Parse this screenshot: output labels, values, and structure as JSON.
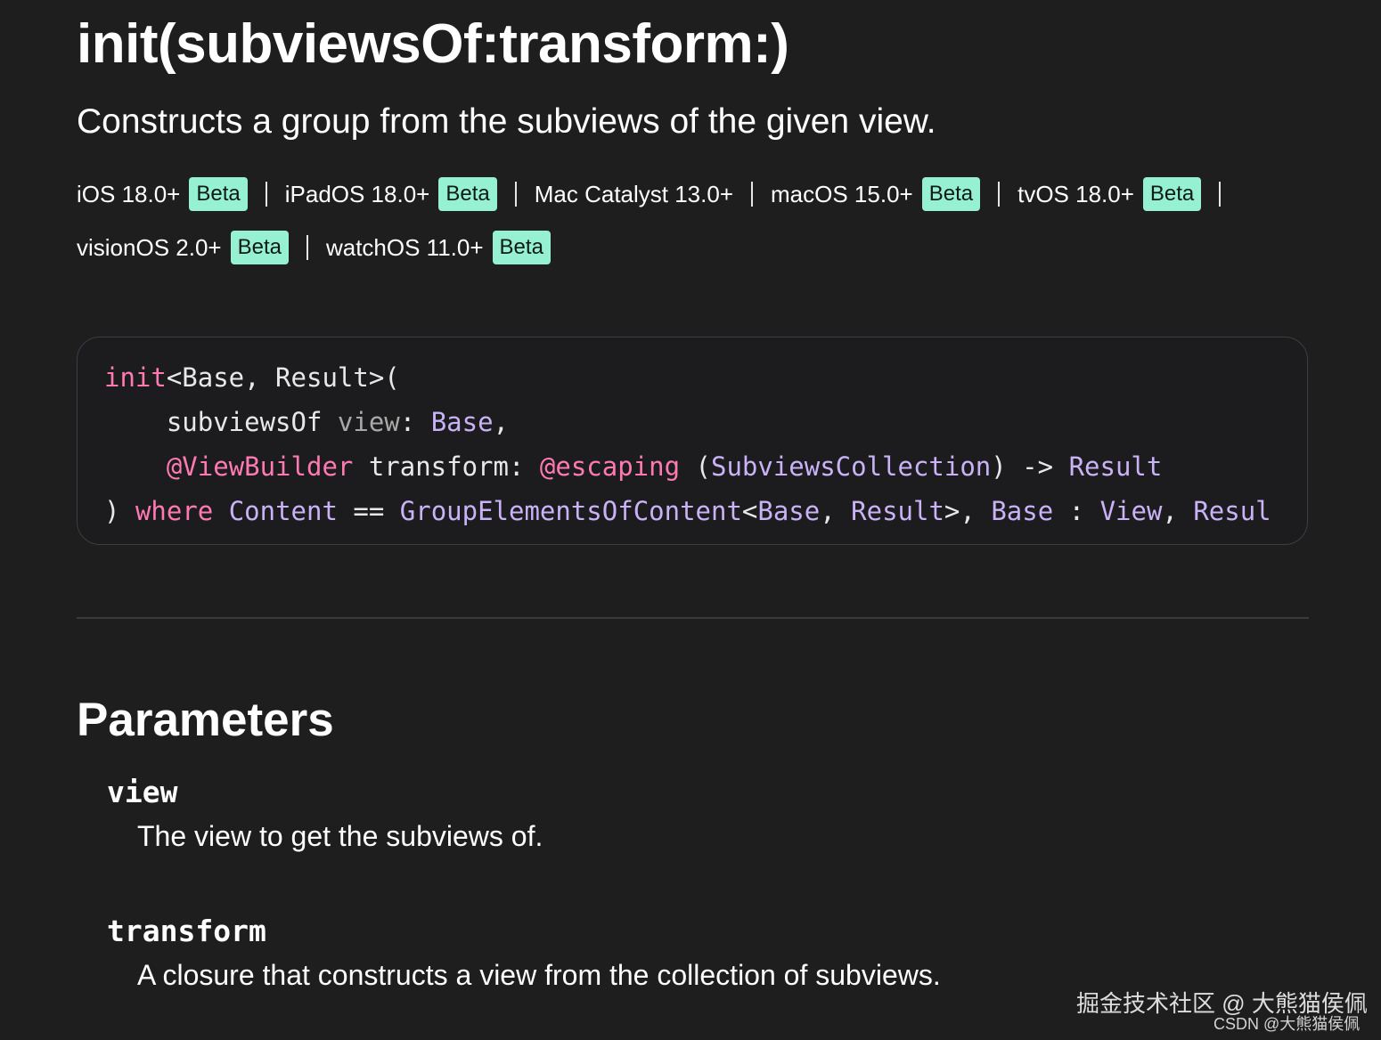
{
  "title": "init(subviewsOf:transform:)",
  "abstract": "Constructs a group from the subviews of the given view.",
  "availability": {
    "row1": [
      {
        "platform": "iOS 18.0+",
        "badge": "Beta"
      },
      {
        "platform": "iPadOS 18.0+",
        "badge": "Beta"
      },
      {
        "platform": "Mac Catalyst 13.0+"
      },
      {
        "platform": "macOS 15.0+",
        "badge": "Beta"
      },
      {
        "platform": "tvOS 18.0+",
        "badge": "Beta"
      }
    ],
    "row2": [
      {
        "platform": "visionOS 2.0+",
        "badge": "Beta"
      },
      {
        "platform": "watchOS 11.0+",
        "badge": "Beta"
      }
    ],
    "badge_color": "#96f0d2"
  },
  "declaration": {
    "line1": {
      "kw": "init",
      "rest": "<Base, Result>("
    },
    "line2": {
      "label": "subviewsOf",
      "param": "view",
      "colon": ":",
      "type": "Base",
      "comma": ","
    },
    "line3": {
      "attr": "@ViewBuilder",
      "label": "transform",
      "colon": ":",
      "escaping": "@escaping",
      "open": "(",
      "type1": "SubviewsCollection",
      "arrow": ") ->",
      "type2": "Result"
    },
    "line4": {
      "close": ")",
      "where": "where",
      "content": "Content",
      "eq": "==",
      "type": "GroupElementsOfContent",
      "lt": "<",
      "base": "Base",
      "comma1": ",",
      "result": "Result",
      "gt": ">,",
      "base2": "Base",
      "colon": ":",
      "view": "View",
      "comma2": ",",
      "resul": "Resul"
    },
    "colors": {
      "keyword": "#ff7ab2",
      "type": "#c9b2f5",
      "param": "#a8a8a8"
    }
  },
  "parameters": {
    "heading": "Parameters",
    "items": [
      {
        "name": "view",
        "description": "The view to get the subviews of."
      },
      {
        "name": "transform",
        "description": "A closure that constructs a view from the collection of subviews."
      }
    ]
  },
  "watermark": {
    "line1": "掘金技术社区 @ 大熊猫侯佩",
    "line2": "CSDN @大熊猫侯佩"
  }
}
